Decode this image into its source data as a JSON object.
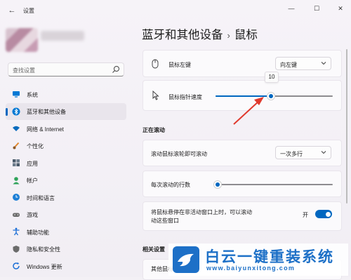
{
  "app": {
    "title": "设置",
    "back_icon": "back-arrow-icon",
    "window_controls": [
      "minimize-icon",
      "maximize-icon",
      "close-icon"
    ]
  },
  "profile": {
    "avatar": "blurred-avatar",
    "name": ""
  },
  "search": {
    "placeholder": "查找设置",
    "icon": "search-icon"
  },
  "sidebar": {
    "items": [
      {
        "label": "系统",
        "icon": "monitor-icon",
        "color": "#0078d4",
        "active": false
      },
      {
        "label": "蓝牙和其他设备",
        "icon": "bluetooth-icon",
        "color": "#0078d4",
        "active": true
      },
      {
        "label": "网络 & Internet",
        "icon": "wifi-icon",
        "color": "#0b6cbd",
        "active": false
      },
      {
        "label": "个性化",
        "icon": "brush-icon",
        "color": "#e0862b",
        "active": false
      },
      {
        "label": "应用",
        "icon": "apps-icon",
        "color": "#4a5a6a",
        "active": false
      },
      {
        "label": "帐户",
        "icon": "person-icon",
        "color": "#2fa35a",
        "active": false
      },
      {
        "label": "时间和语言",
        "icon": "globe-clock-icon",
        "color": "#1c7fd6",
        "active": false
      },
      {
        "label": "游戏",
        "icon": "gamepad-icon",
        "color": "#6b6b6b",
        "active": false
      },
      {
        "label": "辅助功能",
        "icon": "accessibility-icon",
        "color": "#1c6fd6",
        "active": false
      },
      {
        "label": "隐私和安全性",
        "icon": "shield-icon",
        "color": "#6b6b6b",
        "active": false
      },
      {
        "label": "Windows 更新",
        "icon": "update-icon",
        "color": "#1c6fd6",
        "active": false
      }
    ]
  },
  "main": {
    "breadcrumb": {
      "parent": "蓝牙和其他设备",
      "separator": "›",
      "current": "鼠标"
    },
    "primary_button": {
      "label": "鼠标左键",
      "icon": "mouse-icon",
      "value": "向左键"
    },
    "pointer_speed": {
      "label": "鼠标指针速度",
      "icon": "cursor-icon",
      "value": 10,
      "min": 1,
      "max": 20,
      "tooltip": "10"
    },
    "scrolling": {
      "title": "正在滚动",
      "wheel_scroll": {
        "label": "滚动鼠标滚轮即可滚动",
        "value": "一次多行"
      },
      "lines_per_scroll": {
        "label": "每次滚动的行数",
        "value": 3,
        "min": 1,
        "max": 100
      },
      "inactive_scroll": {
        "label_line1": "将鼠标悬停在非活动窗口上时，可以滚动",
        "label_line2": "动这些窗口",
        "state": "开",
        "on": true
      }
    },
    "related": {
      "title": "相关设置",
      "item_label": "其他鼠标"
    }
  },
  "accent_color": "#0067c0",
  "watermark": {
    "title": "白云一键重装系统",
    "url": "www.baiyunxitong.com",
    "color": "#1d70c7"
  }
}
